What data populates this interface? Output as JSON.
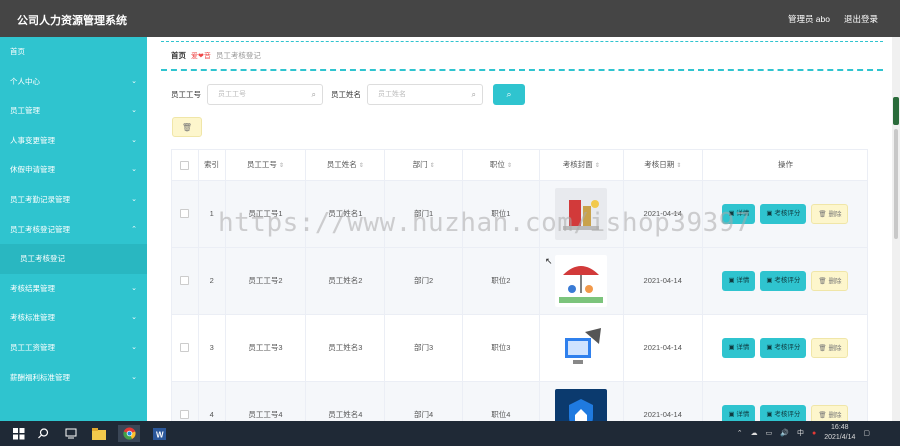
{
  "app": {
    "title": "公司人力资源管理系统"
  },
  "topbar": {
    "admin_label": "管理员 abo",
    "logout_label": "退出登录"
  },
  "sidebar": {
    "items": [
      {
        "label": "首页",
        "chevron": ""
      },
      {
        "label": "个人中心",
        "chevron": "⌄"
      },
      {
        "label": "员工管理",
        "chevron": "⌄"
      },
      {
        "label": "人事变更管理",
        "chevron": "⌄"
      },
      {
        "label": "休假申请管理",
        "chevron": "⌄"
      },
      {
        "label": "员工考勤记录管理",
        "chevron": "⌄"
      },
      {
        "label": "员工考核登记管理",
        "chevron": "⌃"
      },
      {
        "label": "员工考核登记",
        "chevron": ""
      },
      {
        "label": "考核结果管理",
        "chevron": "⌄"
      },
      {
        "label": "考核标准管理",
        "chevron": "⌄"
      },
      {
        "label": "员工工资管理",
        "chevron": "⌄"
      },
      {
        "label": "薪酬福利标准管理",
        "chevron": "⌄"
      }
    ]
  },
  "breadcrumb": {
    "home": "首页",
    "sep": "爱❤音",
    "current": "员工考核登记"
  },
  "search": {
    "label1": "员工工号",
    "placeholder1": "员工工号",
    "label2": "员工姓名",
    "placeholder2": "员工姓名",
    "search_icon": "search-icon"
  },
  "delete_icon": "trash-icon",
  "table": {
    "headers": [
      "",
      "索引",
      "员工工号",
      "员工姓名",
      "部门",
      "职位",
      "考核封面",
      "考核日期",
      "操作"
    ],
    "rows": [
      {
        "index": "1",
        "emp_no": "员工工号1",
        "emp_name": "员工姓名1",
        "dept": "部门1",
        "position": "职位1",
        "date": "2021-04-14"
      },
      {
        "index": "2",
        "emp_no": "员工工号2",
        "emp_name": "员工姓名2",
        "dept": "部门2",
        "position": "职位2",
        "date": "2021-04-14"
      },
      {
        "index": "3",
        "emp_no": "员工工号3",
        "emp_name": "员工姓名3",
        "dept": "部门3",
        "position": "职位3",
        "date": "2021-04-14"
      },
      {
        "index": "4",
        "emp_no": "员工工号4",
        "emp_name": "员工姓名4",
        "dept": "部门4",
        "position": "职位4",
        "date": "2021-04-14"
      }
    ],
    "actions": {
      "detail": "详情",
      "evaluate": "考核评分",
      "delete": "删除"
    }
  },
  "watermark": "https://www.huzhan.com/ishop39397",
  "taskbar": {
    "ime": "中",
    "time": "16:48",
    "date": "2021/4/14"
  },
  "colors": {
    "accent": "#2fc4cf",
    "topbar": "#454545",
    "delete_bg": "#fdf6cc"
  }
}
